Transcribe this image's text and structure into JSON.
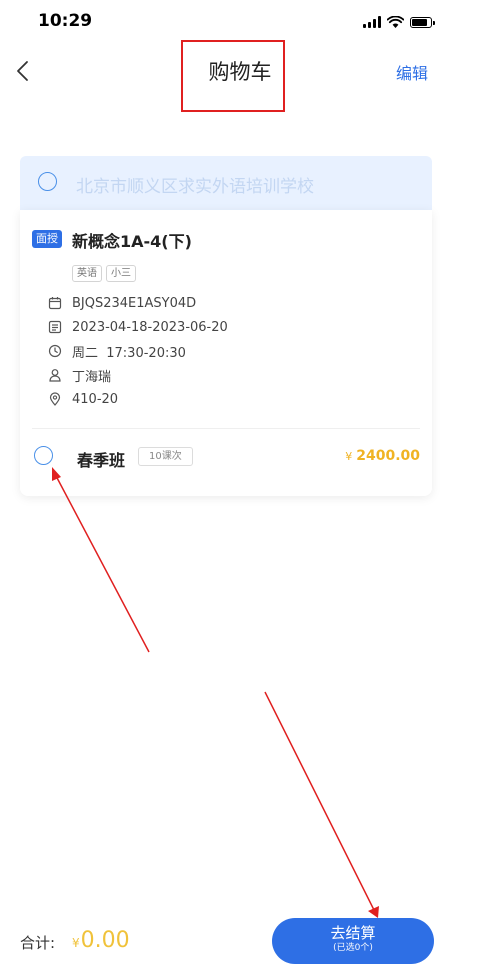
{
  "status_bar": {
    "time": "10:29",
    "signal_icon": "signal-icon",
    "wifi_icon": "wifi-icon",
    "battery_icon": "battery-icon"
  },
  "nav": {
    "title": "购物车",
    "edit_label": "编辑",
    "back_icon": "chevron-left-icon"
  },
  "school": {
    "name": "北京市顺义区求实外语培训学校"
  },
  "course": {
    "mode_badge": "面授",
    "title": "新概念1A-4(下)",
    "tags": [
      "英语",
      "小三"
    ],
    "code": "BJQS234E1ASY04D",
    "date_range": "2023-04-18-2023-06-20",
    "schedule": "周二  17:30-20:30",
    "teacher": "丁海瑞",
    "room": "410-20",
    "class_name": "春季班",
    "lesson_count": "10课次",
    "currency": "¥",
    "price": "2400.00"
  },
  "footer": {
    "total_label": "合计:",
    "currency": "¥",
    "total": "0.00",
    "checkout_label": "去结算",
    "checkout_sub": "(已选0个)"
  },
  "colors": {
    "accent": "#2e6fe5",
    "price": "#f0b323",
    "annotation": "#e02020"
  }
}
